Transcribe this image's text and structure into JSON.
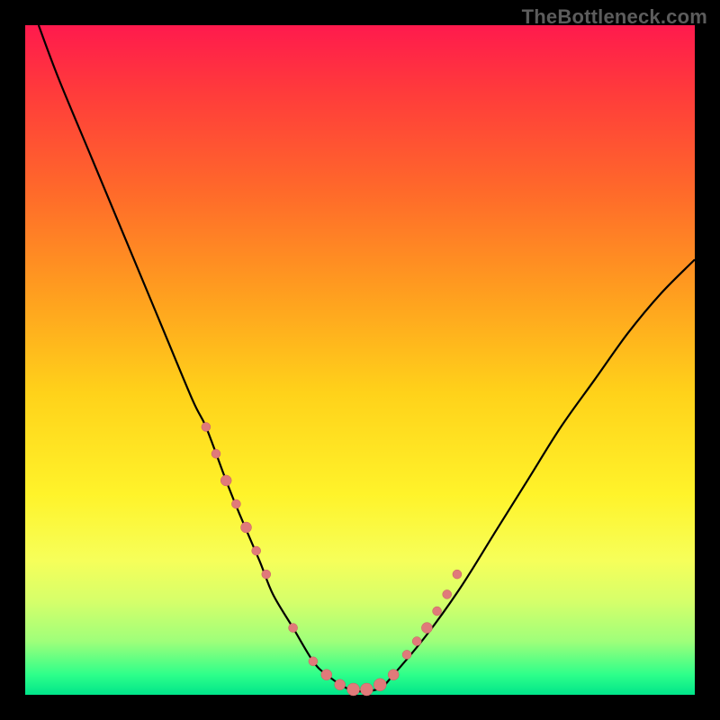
{
  "watermark": "TheBottleneck.com",
  "colors": {
    "background": "#000000",
    "curve": "#000000",
    "marker_fill": "#e07a7a",
    "marker_stroke": "#c95f5f"
  },
  "chart_data": {
    "type": "line",
    "title": "",
    "xlabel": "",
    "ylabel": "",
    "xlim": [
      0,
      100
    ],
    "ylim": [
      0,
      100
    ],
    "series": [
      {
        "name": "bottleneck-curve",
        "x": [
          2,
          5,
          10,
          15,
          20,
          25,
          27,
          30,
          32,
          35,
          37,
          40,
          43,
          45,
          48,
          50,
          53,
          55,
          60,
          65,
          70,
          75,
          80,
          85,
          90,
          95,
          100
        ],
        "y": [
          100,
          92,
          80,
          68,
          56,
          44,
          40,
          32,
          27,
          20,
          15,
          10,
          5,
          3,
          1,
          0.5,
          1,
          3,
          9,
          16,
          24,
          32,
          40,
          47,
          54,
          60,
          65
        ]
      }
    ],
    "markers": {
      "name": "highlight-points",
      "x": [
        27,
        28.5,
        30,
        31.5,
        33,
        34.5,
        36,
        40,
        43,
        45,
        47,
        49,
        51,
        53,
        55,
        57,
        58.5,
        60,
        61.5,
        63,
        64.5
      ],
      "y": [
        40,
        36,
        32,
        28.5,
        25,
        21.5,
        18,
        10,
        5,
        3,
        1.5,
        0.8,
        0.8,
        1.5,
        3,
        6,
        8,
        10,
        12.5,
        15,
        18
      ],
      "r": [
        5,
        5,
        6,
        5,
        6,
        5,
        5,
        5,
        5,
        6,
        6,
        7,
        7,
        7,
        6,
        5,
        5,
        6,
        5,
        5,
        5
      ]
    }
  }
}
